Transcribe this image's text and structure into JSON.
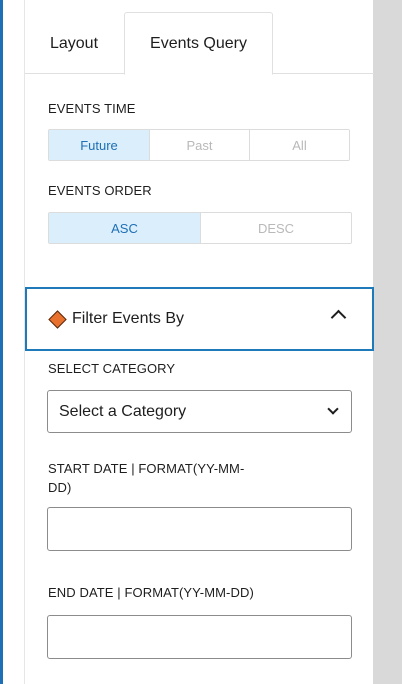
{
  "tabs": [
    {
      "label": "Layout"
    },
    {
      "label": "Events Query"
    }
  ],
  "events_time": {
    "label": "EVENTS TIME",
    "options": [
      "Future",
      "Past",
      "All"
    ],
    "selected": "Future"
  },
  "events_order": {
    "label": "EVENTS ORDER",
    "options": [
      "ASC",
      "DESC"
    ],
    "selected": "ASC"
  },
  "filter": {
    "title": "Filter Events By",
    "icon": "diamond-icon",
    "expanded": true
  },
  "category": {
    "label": "SELECT CATEGORY",
    "value": "Select a Category"
  },
  "start_date": {
    "label_line1": "START DATE | FORMAT(YY-MM-",
    "label_line2": "DD)",
    "value": ""
  },
  "end_date": {
    "label": "END DATE | FORMAT(YY-MM-DD)",
    "value": ""
  },
  "colors": {
    "accent": "#1e6fb5",
    "active_bg": "#dbeefc",
    "diamond": "#e8722d"
  }
}
